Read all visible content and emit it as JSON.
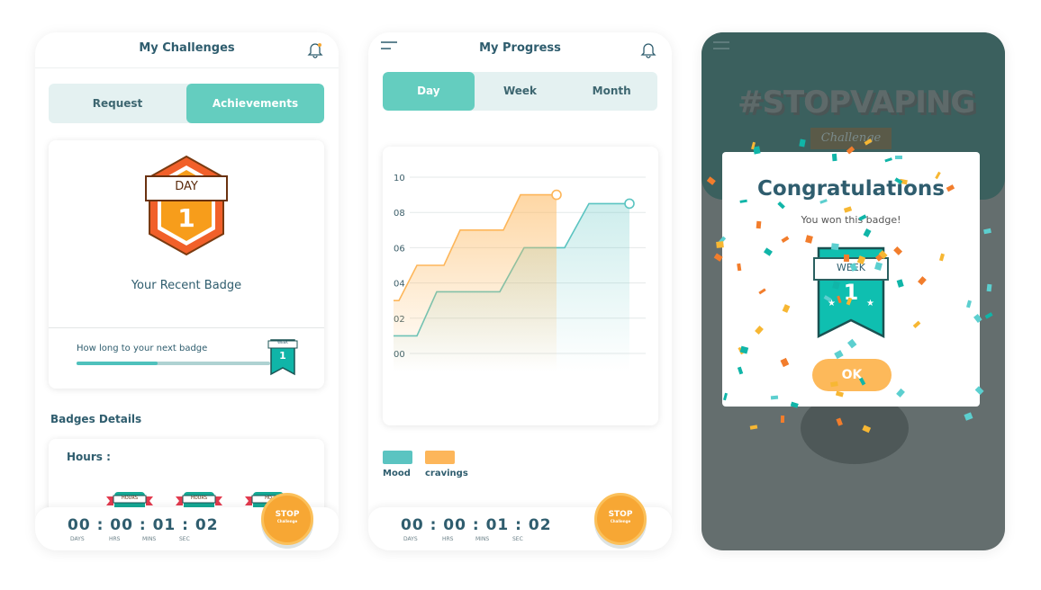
{
  "challenges": {
    "title": "My Challenges",
    "tabs": [
      "Request",
      "Achievements"
    ],
    "active_tab": "Achievements",
    "recent_badge": {
      "label": "DAY",
      "number": "1",
      "caption": "Your Recent Badge"
    },
    "next_badge": {
      "label": "How long to your next badge",
      "progress": 0.42,
      "badge_label": "WEEK",
      "badge_number": "1"
    },
    "details_title": "Badges Details",
    "hours_label": "Hours :",
    "hour_badges": [
      {
        "label": "HOURS"
      },
      {
        "label": "HOURS"
      },
      {
        "label": "HO"
      }
    ]
  },
  "timer": {
    "value": "00 : 00 : 01 : 02",
    "units": [
      "DAYS",
      "HRS",
      "MINS",
      "SEC"
    ],
    "stop_label": "STOP",
    "stop_sub": "Challenge"
  },
  "progress": {
    "title": "My Progress",
    "tabs": [
      "Day",
      "Week",
      "Month"
    ],
    "active_tab": "Day"
  },
  "chart_data": {
    "type": "line",
    "style": "step-area",
    "yticks": [
      "10",
      "08",
      "06",
      "04",
      "02",
      "00"
    ],
    "ylim": [
      0,
      10
    ],
    "grid": true,
    "legend_placement": "bottom-left",
    "series": [
      {
        "name": "Mood",
        "color": "#5bc4c1",
        "values": [
          1,
          3.5,
          6,
          8.5
        ]
      },
      {
        "name": "cravings",
        "color": "#fdb65a",
        "values": [
          3,
          5,
          7,
          9
        ]
      }
    ]
  },
  "congrats": {
    "bg_title": "#STOPVAPING",
    "bg_sub": "Challenge",
    "title": "Congratulations",
    "subtitle": "You won this badge!",
    "badge_label": "WEEK",
    "badge_number": "1",
    "ok_label": "OK"
  },
  "colors": {
    "teal": "#64cdbf",
    "orange": "#f7a734",
    "dark": "#2f5d6e",
    "overlay_top": "#3b605e"
  }
}
